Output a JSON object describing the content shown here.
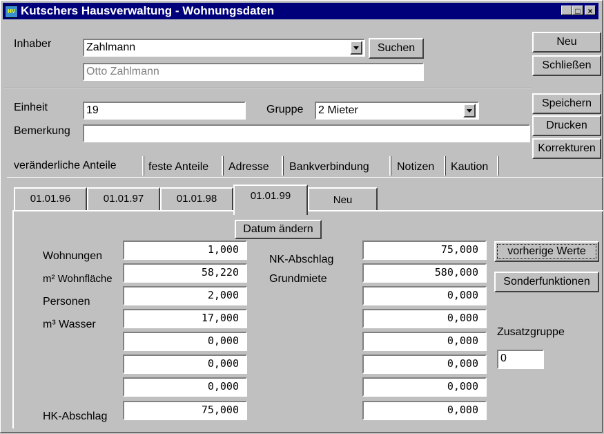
{
  "window": {
    "title": "Kutschers Hausverwaltung - Wohnungsdaten",
    "icon": "HV",
    "controls": [
      "minimize",
      "maximize",
      "close"
    ]
  },
  "owner": {
    "label": "Inhaber",
    "value": "Zahlmann",
    "fullname": "Otto Zahlmann",
    "search_label": "Suchen"
  },
  "side_buttons": {
    "new": "Neu",
    "close": "Schließen",
    "save": "Speichern",
    "print": "Drucken",
    "corrections": "Korrekturen"
  },
  "unit": {
    "label": "Einheit",
    "value": "19",
    "group_label": "Gruppe",
    "group_value": "2 Mieter",
    "remark_label": "Bemerkung",
    "remark_value": ""
  },
  "tabs": [
    "veränderliche Anteile",
    "feste Anteile",
    "Adresse",
    "Bankverbindung",
    "Notizen",
    "Kaution"
  ],
  "date_tabs": [
    "01.01.96",
    "01.01.97",
    "01.01.98",
    "01.01.99",
    "Neu"
  ],
  "change_date_label": "Datum ändern",
  "left_labels": [
    "Wohnungen",
    "m² Wohnfläche",
    "Personen",
    "m³ Wasser",
    "HK-Abschlag"
  ],
  "left_values": [
    "1,000",
    "58,220",
    "2,000",
    "17,000",
    "0,000",
    "0,000",
    "0,000",
    "75,000"
  ],
  "right_labels": [
    "NK-Abschlag",
    "Grundmiete"
  ],
  "right_values": [
    "75,000",
    "580,000",
    "0,000",
    "0,000",
    "0,000",
    "0,000",
    "0,000",
    "0,000"
  ],
  "buttons": {
    "previous": "vorherige Werte",
    "special": "Sonderfunktionen"
  },
  "extra_group": {
    "label": "Zusatzgruppe",
    "value": "0"
  }
}
